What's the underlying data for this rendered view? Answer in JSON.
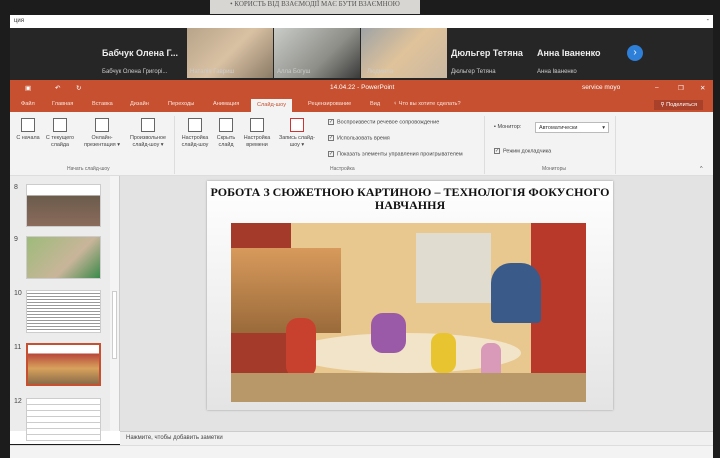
{
  "background_text": "• КОРИСТЬ ВІД ВЗАЄМОДІЇ МАЄ БУТИ ВЗАЄМНОЮ",
  "window": {
    "title": "ция",
    "minimize": "-"
  },
  "teams": {
    "participants": [
      {
        "name": "Бабчук Олена Г...",
        "label": "Бабчук Олена Григорі..."
      },
      {
        "label": "Наталія Гавриш"
      },
      {
        "label": "Алла Богуш"
      },
      {
        "label": "Людмила"
      },
      {
        "name": "Дюльгер Тетяна",
        "label": "Дюльгер Тетяна"
      },
      {
        "name": "Анна Іваненко",
        "label": "Анна Іваненко"
      }
    ],
    "next": "›"
  },
  "ppt": {
    "title": "14.04.22 - PowerPoint",
    "user": "service moyo",
    "tabs": [
      "Файл",
      "Главная",
      "Вставка",
      "Дизайн",
      "Переходы",
      "Анимация",
      "Слайд-шоу",
      "Рецензирование",
      "Вид"
    ],
    "active_tab": "Слайд-шоу",
    "tellme": "Что вы хотите сделать?",
    "share": "Поделиться",
    "ribbon": {
      "start": [
        "С начала",
        "С текущего слайда",
        "Онлайн-презентация ▾",
        "Произвольное слайд-шоу ▾"
      ],
      "setup": [
        "Настройка слайд-шоу",
        "Скрыть слайд",
        "Настройка времени",
        "Запись слайд-шоу ▾"
      ],
      "checks": [
        "Воспроизвести речевое сопровождение",
        "Использовать время",
        "Показать элементы управления проигрывателем"
      ],
      "monitor_label": "Монитор:",
      "monitor_value": "Автоматически",
      "presenter": "Режим докладчика",
      "groups": [
        "Начать слайд-шоу",
        "Настройка",
        "Мониторы"
      ]
    },
    "slides": [
      "8",
      "9",
      "10",
      "11",
      "12"
    ],
    "current_slide": "11",
    "slide_title": "РОБОТА З СЮЖЕТНОЮ КАРТИНОЮ – ТЕХНОЛОГІЯ ФОКУСНОГО НАВЧАННЯ",
    "notes": "Нажмите, чтобы добавить заметки",
    "accent": "#c6502f"
  }
}
